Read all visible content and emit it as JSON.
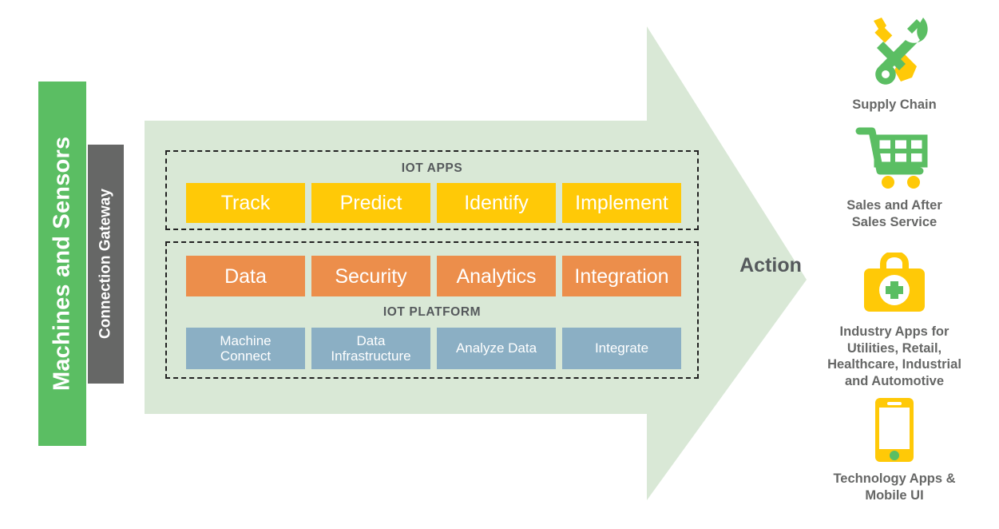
{
  "left_rail": {
    "machines_label": "Machines and Sensors",
    "gateway_label": "Connection Gateway",
    "machines_color": "#5BBE63",
    "gateway_color": "#666766"
  },
  "flow_arrow": {
    "label": "Action",
    "fill_color": "#D9E8D6"
  },
  "iot_apps": {
    "title": "IOT APPS",
    "card_color": "#FFC907",
    "cards": [
      {
        "label": "Track"
      },
      {
        "label": "Predict"
      },
      {
        "label": "Identify"
      },
      {
        "label": "Implement"
      }
    ]
  },
  "iot_platform": {
    "title": "IOT PLATFORM",
    "capability_color": "#EC8E4B",
    "capabilities": [
      {
        "label": "Data"
      },
      {
        "label": "Security"
      },
      {
        "label": "Analytics"
      },
      {
        "label": "Integration"
      }
    ],
    "function_color": "#8BAFC4",
    "functions": [
      {
        "label": "Machine\nConnect"
      },
      {
        "label": "Data\nInfrastructure"
      },
      {
        "label": "Analyze Data"
      },
      {
        "label": "Integrate"
      }
    ]
  },
  "outcomes": [
    {
      "icon": "wrench-screwdriver-icon",
      "caption": "Supply Chain"
    },
    {
      "icon": "shopping-cart-icon",
      "caption": "Sales and After\nSales Service"
    },
    {
      "icon": "first-aid-kit-icon",
      "caption": "Industry Apps for\nUtilities, Retail,\nHealthcare, Industrial\nand Automotive"
    },
    {
      "icon": "smartphone-icon",
      "caption": "Technology Apps &\nMobile UI"
    }
  ],
  "palette": {
    "green": "#5BBE63",
    "yellow": "#FFC907",
    "orange": "#EC8E4B",
    "blue": "#8BAFC4",
    "gray": "#666766",
    "light_green": "#D9E8D6",
    "text_gray": "#55595c"
  }
}
